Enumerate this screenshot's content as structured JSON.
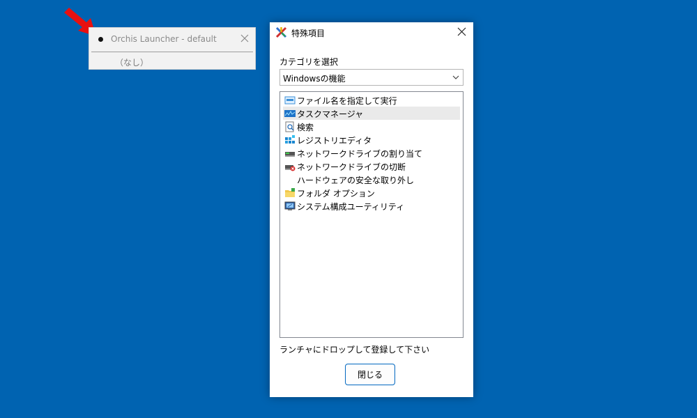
{
  "launcher": {
    "title": "Orchis Launcher - default",
    "empty_label": "（なし）"
  },
  "dialog": {
    "title": "特殊項目",
    "category_label": "カテゴリを選択",
    "category_value": "Windowsの機能",
    "items": [
      {
        "label": "ファイル名を指定して実行",
        "icon": "run-dialog-icon"
      },
      {
        "label": "タスクマネージャ",
        "icon": "task-manager-icon",
        "selected": true
      },
      {
        "label": "検索",
        "icon": "search-icon"
      },
      {
        "label": "レジストリエディタ",
        "icon": "registry-editor-icon"
      },
      {
        "label": "ネットワークドライブの割り当て",
        "icon": "map-network-drive-icon"
      },
      {
        "label": "ネットワークドライブの切断",
        "icon": "disconnect-network-drive-icon"
      },
      {
        "label": "ハードウェアの安全な取り外し",
        "icon": "none"
      },
      {
        "label": "フォルダ オプション",
        "icon": "folder-options-icon"
      },
      {
        "label": "システム構成ユーティリティ",
        "icon": "system-config-icon"
      }
    ],
    "hint": "ランチャにドロップして登録して下さい",
    "close_button": "閉じる"
  },
  "colors": {
    "desktop": "#0063b1",
    "accent": "#0067c0",
    "pointer": "#e81010"
  }
}
